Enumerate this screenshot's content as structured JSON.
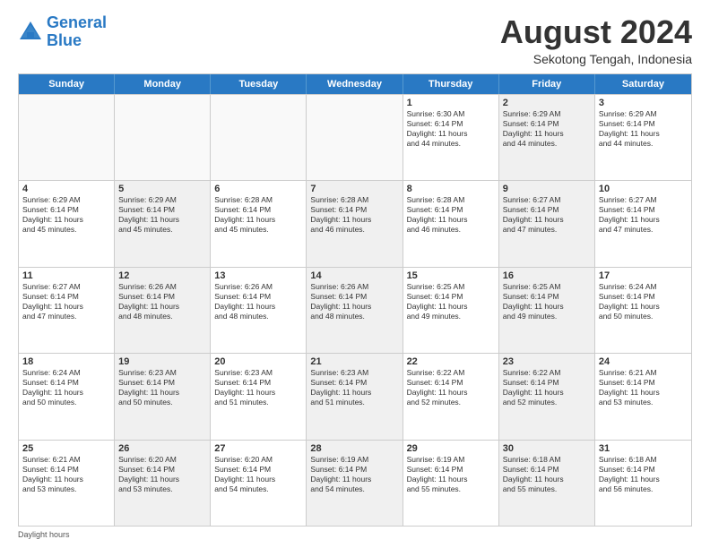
{
  "logo": {
    "line1": "General",
    "line2": "Blue"
  },
  "header": {
    "month": "August 2024",
    "location": "Sekotong Tengah, Indonesia"
  },
  "days_of_week": [
    "Sunday",
    "Monday",
    "Tuesday",
    "Wednesday",
    "Thursday",
    "Friday",
    "Saturday"
  ],
  "footer_text": "Daylight hours",
  "weeks": [
    [
      {
        "day": "",
        "info": "",
        "shaded": false,
        "empty": true
      },
      {
        "day": "",
        "info": "",
        "shaded": false,
        "empty": true
      },
      {
        "day": "",
        "info": "",
        "shaded": false,
        "empty": true
      },
      {
        "day": "",
        "info": "",
        "shaded": false,
        "empty": true
      },
      {
        "day": "1",
        "info": "Sunrise: 6:30 AM\nSunset: 6:14 PM\nDaylight: 11 hours\nand 44 minutes.",
        "shaded": false,
        "empty": false
      },
      {
        "day": "2",
        "info": "Sunrise: 6:29 AM\nSunset: 6:14 PM\nDaylight: 11 hours\nand 44 minutes.",
        "shaded": true,
        "empty": false
      },
      {
        "day": "3",
        "info": "Sunrise: 6:29 AM\nSunset: 6:14 PM\nDaylight: 11 hours\nand 44 minutes.",
        "shaded": false,
        "empty": false
      }
    ],
    [
      {
        "day": "4",
        "info": "Sunrise: 6:29 AM\nSunset: 6:14 PM\nDaylight: 11 hours\nand 45 minutes.",
        "shaded": false,
        "empty": false
      },
      {
        "day": "5",
        "info": "Sunrise: 6:29 AM\nSunset: 6:14 PM\nDaylight: 11 hours\nand 45 minutes.",
        "shaded": true,
        "empty": false
      },
      {
        "day": "6",
        "info": "Sunrise: 6:28 AM\nSunset: 6:14 PM\nDaylight: 11 hours\nand 45 minutes.",
        "shaded": false,
        "empty": false
      },
      {
        "day": "7",
        "info": "Sunrise: 6:28 AM\nSunset: 6:14 PM\nDaylight: 11 hours\nand 46 minutes.",
        "shaded": true,
        "empty": false
      },
      {
        "day": "8",
        "info": "Sunrise: 6:28 AM\nSunset: 6:14 PM\nDaylight: 11 hours\nand 46 minutes.",
        "shaded": false,
        "empty": false
      },
      {
        "day": "9",
        "info": "Sunrise: 6:27 AM\nSunset: 6:14 PM\nDaylight: 11 hours\nand 47 minutes.",
        "shaded": true,
        "empty": false
      },
      {
        "day": "10",
        "info": "Sunrise: 6:27 AM\nSunset: 6:14 PM\nDaylight: 11 hours\nand 47 minutes.",
        "shaded": false,
        "empty": false
      }
    ],
    [
      {
        "day": "11",
        "info": "Sunrise: 6:27 AM\nSunset: 6:14 PM\nDaylight: 11 hours\nand 47 minutes.",
        "shaded": false,
        "empty": false
      },
      {
        "day": "12",
        "info": "Sunrise: 6:26 AM\nSunset: 6:14 PM\nDaylight: 11 hours\nand 48 minutes.",
        "shaded": true,
        "empty": false
      },
      {
        "day": "13",
        "info": "Sunrise: 6:26 AM\nSunset: 6:14 PM\nDaylight: 11 hours\nand 48 minutes.",
        "shaded": false,
        "empty": false
      },
      {
        "day": "14",
        "info": "Sunrise: 6:26 AM\nSunset: 6:14 PM\nDaylight: 11 hours\nand 48 minutes.",
        "shaded": true,
        "empty": false
      },
      {
        "day": "15",
        "info": "Sunrise: 6:25 AM\nSunset: 6:14 PM\nDaylight: 11 hours\nand 49 minutes.",
        "shaded": false,
        "empty": false
      },
      {
        "day": "16",
        "info": "Sunrise: 6:25 AM\nSunset: 6:14 PM\nDaylight: 11 hours\nand 49 minutes.",
        "shaded": true,
        "empty": false
      },
      {
        "day": "17",
        "info": "Sunrise: 6:24 AM\nSunset: 6:14 PM\nDaylight: 11 hours\nand 50 minutes.",
        "shaded": false,
        "empty": false
      }
    ],
    [
      {
        "day": "18",
        "info": "Sunrise: 6:24 AM\nSunset: 6:14 PM\nDaylight: 11 hours\nand 50 minutes.",
        "shaded": false,
        "empty": false
      },
      {
        "day": "19",
        "info": "Sunrise: 6:23 AM\nSunset: 6:14 PM\nDaylight: 11 hours\nand 50 minutes.",
        "shaded": true,
        "empty": false
      },
      {
        "day": "20",
        "info": "Sunrise: 6:23 AM\nSunset: 6:14 PM\nDaylight: 11 hours\nand 51 minutes.",
        "shaded": false,
        "empty": false
      },
      {
        "day": "21",
        "info": "Sunrise: 6:23 AM\nSunset: 6:14 PM\nDaylight: 11 hours\nand 51 minutes.",
        "shaded": true,
        "empty": false
      },
      {
        "day": "22",
        "info": "Sunrise: 6:22 AM\nSunset: 6:14 PM\nDaylight: 11 hours\nand 52 minutes.",
        "shaded": false,
        "empty": false
      },
      {
        "day": "23",
        "info": "Sunrise: 6:22 AM\nSunset: 6:14 PM\nDaylight: 11 hours\nand 52 minutes.",
        "shaded": true,
        "empty": false
      },
      {
        "day": "24",
        "info": "Sunrise: 6:21 AM\nSunset: 6:14 PM\nDaylight: 11 hours\nand 53 minutes.",
        "shaded": false,
        "empty": false
      }
    ],
    [
      {
        "day": "25",
        "info": "Sunrise: 6:21 AM\nSunset: 6:14 PM\nDaylight: 11 hours\nand 53 minutes.",
        "shaded": false,
        "empty": false
      },
      {
        "day": "26",
        "info": "Sunrise: 6:20 AM\nSunset: 6:14 PM\nDaylight: 11 hours\nand 53 minutes.",
        "shaded": true,
        "empty": false
      },
      {
        "day": "27",
        "info": "Sunrise: 6:20 AM\nSunset: 6:14 PM\nDaylight: 11 hours\nand 54 minutes.",
        "shaded": false,
        "empty": false
      },
      {
        "day": "28",
        "info": "Sunrise: 6:19 AM\nSunset: 6:14 PM\nDaylight: 11 hours\nand 54 minutes.",
        "shaded": true,
        "empty": false
      },
      {
        "day": "29",
        "info": "Sunrise: 6:19 AM\nSunset: 6:14 PM\nDaylight: 11 hours\nand 55 minutes.",
        "shaded": false,
        "empty": false
      },
      {
        "day": "30",
        "info": "Sunrise: 6:18 AM\nSunset: 6:14 PM\nDaylight: 11 hours\nand 55 minutes.",
        "shaded": true,
        "empty": false
      },
      {
        "day": "31",
        "info": "Sunrise: 6:18 AM\nSunset: 6:14 PM\nDaylight: 11 hours\nand 56 minutes.",
        "shaded": false,
        "empty": false
      }
    ]
  ]
}
